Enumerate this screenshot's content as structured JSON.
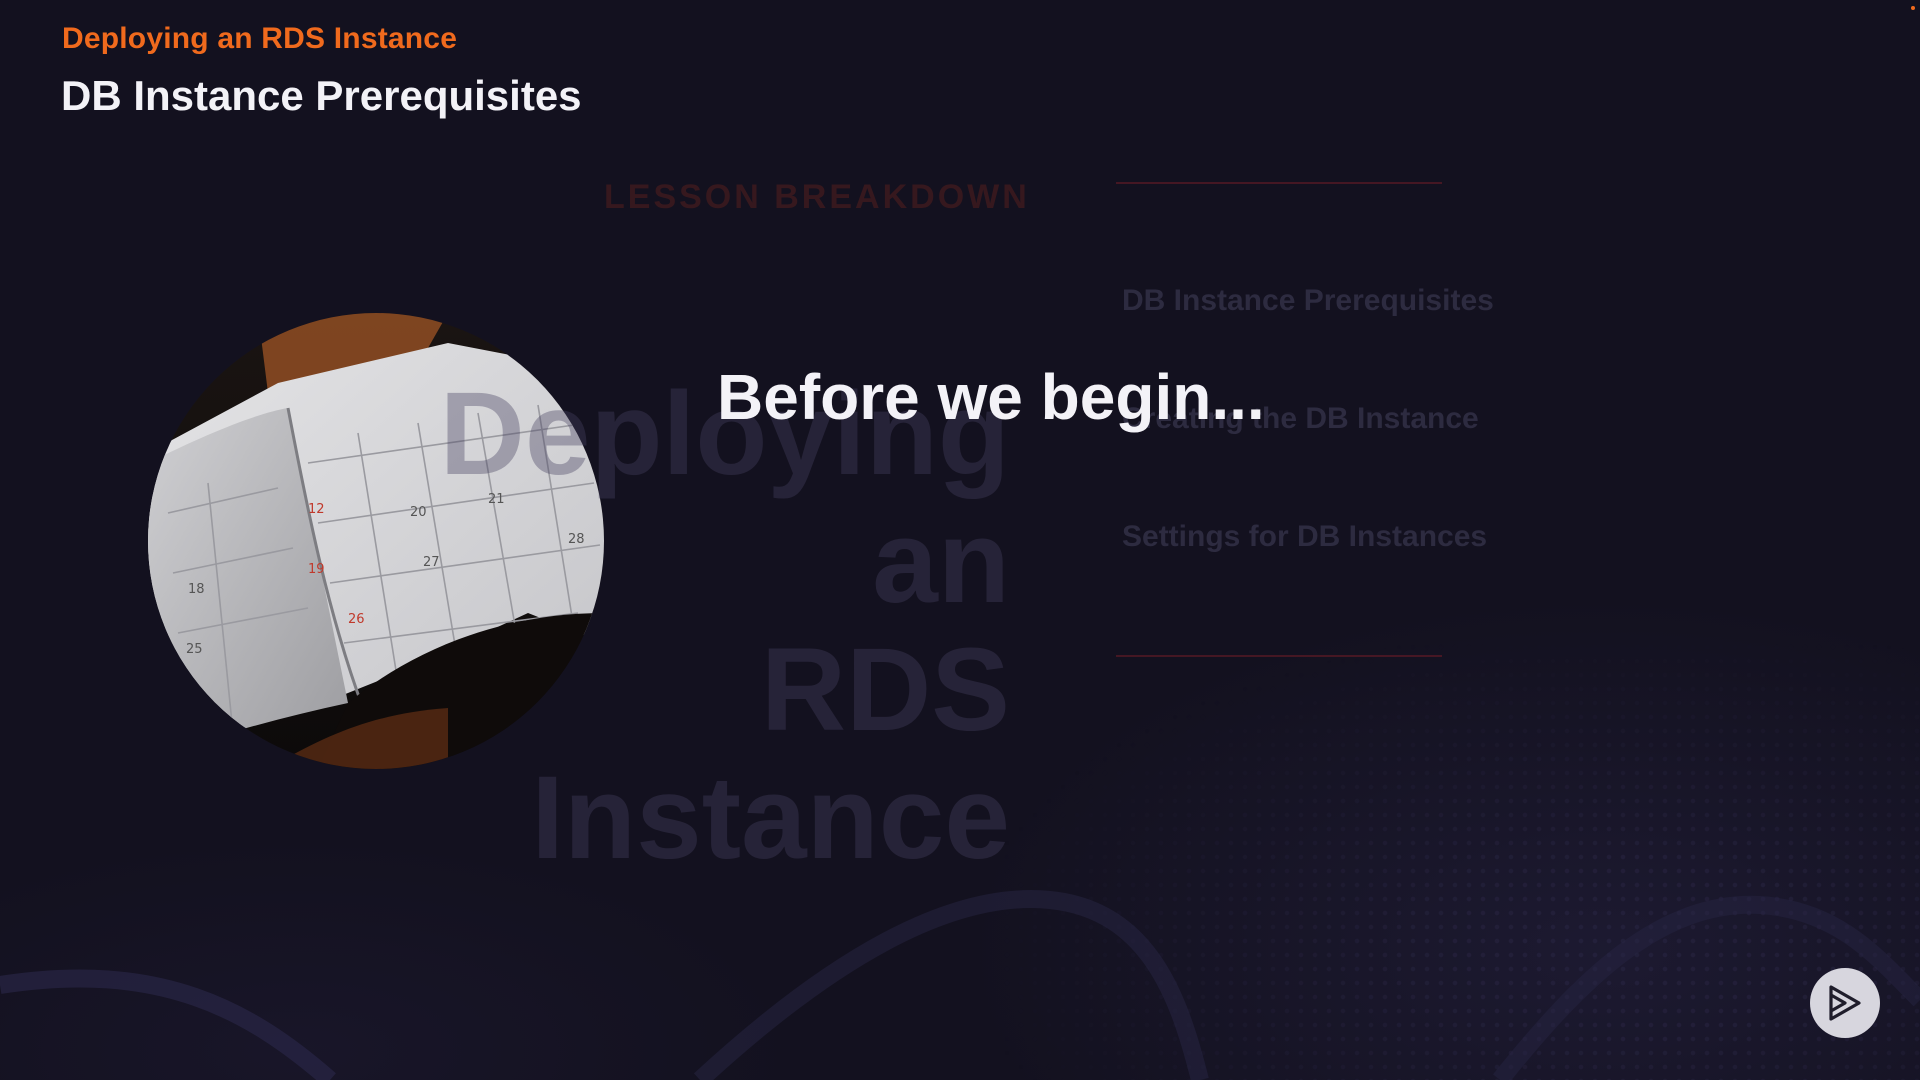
{
  "slide": {
    "course_title": "Deploying an RDS Instance",
    "clip_title": "DB Instance Prerequisites",
    "headline": "Before we begin...",
    "background_ghost": {
      "section_heading": "LESSON BREAKDOWN",
      "course_name_line1": "Deploying an",
      "course_name_line2": "RDS Instance",
      "items": [
        "DB Instance Prerequisites",
        "Creating the DB Instance",
        "Settings for DB Instances"
      ]
    },
    "photo": {
      "subject": "open calendar planner",
      "icon": "calendar-photo"
    }
  },
  "player": {
    "logo_icon": "play-logo-icon"
  },
  "colors": {
    "background": "#13111f",
    "accent": "#f06a1d",
    "title_text": "#f3f2f7",
    "logo_circle": "#d7d6de"
  }
}
